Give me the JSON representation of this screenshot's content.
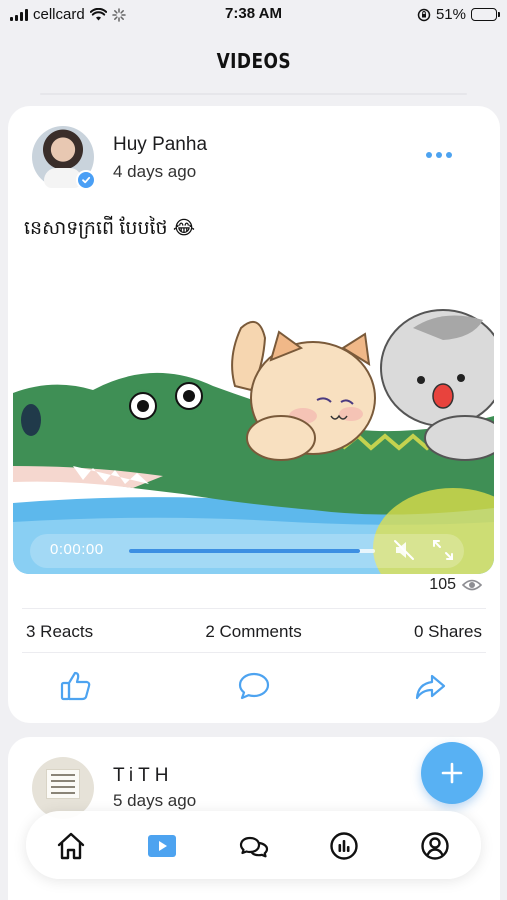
{
  "status_bar": {
    "carrier": "cellcard",
    "time": "7:38 AM",
    "battery_percent": "51%",
    "battery_level": 0.51,
    "icons": [
      "signal-icon",
      "wifi-icon",
      "loading-icon",
      "orientation-lock-icon",
      "battery-icon"
    ]
  },
  "header": {
    "title": "VIDEOS"
  },
  "post": {
    "author_name": "Huy Panha",
    "time_ago": "4 days ago",
    "verified": true,
    "caption": "នេសាទក្រពើ បែបថៃ 😂",
    "video": {
      "current_time": "0:00:00",
      "progress": 0.0,
      "buffered": 0.94,
      "muted": true,
      "icons": [
        "mute-icon",
        "fullscreen-icon"
      ]
    },
    "views": "105",
    "reacts": "3 Reacts",
    "comments": "2 Comments",
    "shares": "0 Shares",
    "action_icons": [
      "like-icon",
      "comment-icon",
      "share-icon"
    ]
  },
  "next_post": {
    "author_name": "TiTH",
    "time_ago": "5 days ago"
  },
  "fab": {
    "icon": "plus-icon"
  },
  "bottom_nav": {
    "items": [
      "home",
      "videos",
      "chat",
      "stats",
      "profile"
    ],
    "active": "videos"
  },
  "colors": {
    "accent": "#4da3f0",
    "fab": "#58b1f3",
    "background": "#f0f0f3"
  }
}
